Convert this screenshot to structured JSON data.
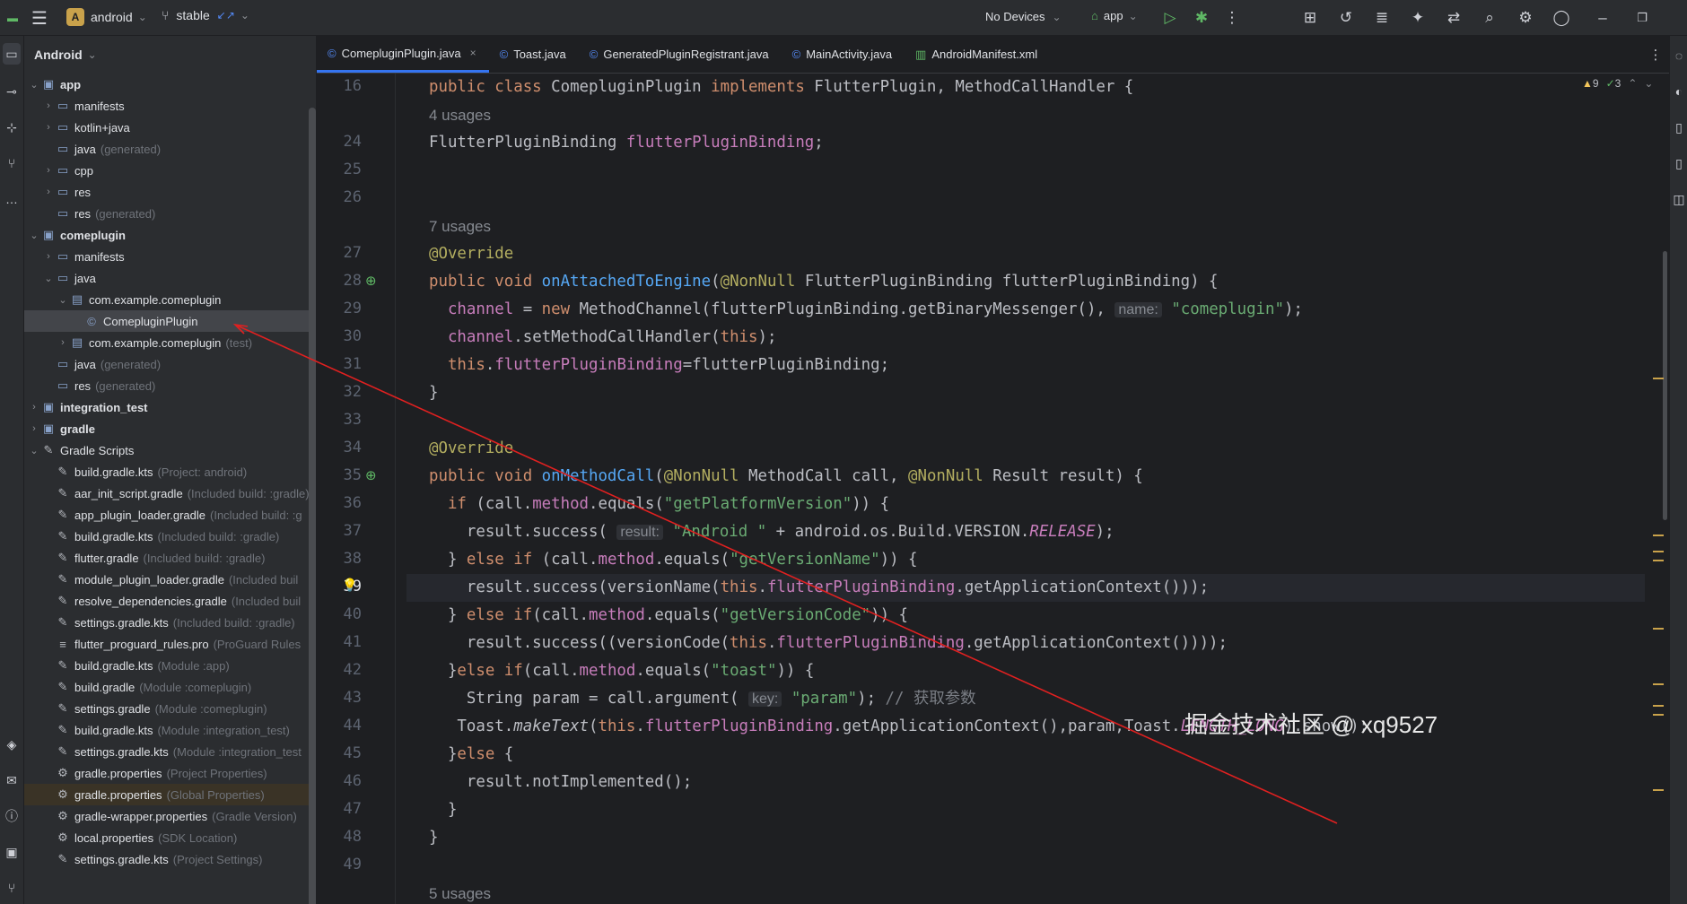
{
  "topbar": {
    "project_badge": "A",
    "project_name": "android",
    "branch": "stable",
    "devices": "No Devices",
    "run_config": "app",
    "chevron": "⌄"
  },
  "project_panel": {
    "header": "Android",
    "tree": [
      {
        "label": "app",
        "hint": "",
        "bold": true,
        "level": 0,
        "chev": "⌄",
        "icon": "folder-module-icon"
      },
      {
        "label": "manifests",
        "hint": "",
        "level": 1,
        "chev": "›",
        "icon": "folder-icon"
      },
      {
        "label": "kotlin+java",
        "hint": "",
        "level": 1,
        "chev": "›",
        "icon": "folder-icon"
      },
      {
        "label": "java",
        "hint": "(generated)",
        "level": 1,
        "chev": "",
        "icon": "folder-icon"
      },
      {
        "label": "cpp",
        "hint": "",
        "level": 1,
        "chev": "›",
        "icon": "folder-icon"
      },
      {
        "label": "res",
        "hint": "",
        "level": 1,
        "chev": "›",
        "icon": "folder-icon"
      },
      {
        "label": "res",
        "hint": "(generated)",
        "level": 1,
        "chev": "",
        "icon": "folder-icon"
      },
      {
        "label": "comeplugin",
        "hint": "",
        "bold": true,
        "level": 0,
        "chev": "⌄",
        "icon": "folder-module-icon"
      },
      {
        "label": "manifests",
        "hint": "",
        "level": 1,
        "chev": "›",
        "icon": "folder-icon"
      },
      {
        "label": "java",
        "hint": "",
        "level": 1,
        "chev": "⌄",
        "icon": "folder-icon"
      },
      {
        "label": "com.example.comeplugin",
        "hint": "",
        "level": 2,
        "chev": "⌄",
        "icon": "package-icon"
      },
      {
        "label": "ComepluginPlugin",
        "hint": "",
        "level": 3,
        "chev": "",
        "icon": "class-icon",
        "selected": true
      },
      {
        "label": "com.example.comeplugin",
        "hint": "(test)",
        "level": 2,
        "chev": "›",
        "icon": "package-icon"
      },
      {
        "label": "java",
        "hint": "(generated)",
        "level": 1,
        "chev": "",
        "icon": "folder-icon"
      },
      {
        "label": "res",
        "hint": "(generated)",
        "level": 1,
        "chev": "",
        "icon": "folder-icon"
      },
      {
        "label": "integration_test",
        "hint": "",
        "bold": true,
        "level": 0,
        "chev": "›",
        "icon": "folder-module-icon"
      },
      {
        "label": "gradle",
        "hint": "",
        "bold": true,
        "level": 0,
        "chev": "›",
        "icon": "folder-module-icon"
      },
      {
        "label": "Gradle Scripts",
        "hint": "",
        "level": 0,
        "chev": "⌄",
        "icon": "gradle-icon"
      },
      {
        "label": "build.gradle.kts",
        "hint": "(Project: android)",
        "level": 1,
        "chev": "",
        "icon": "gradle-icon"
      },
      {
        "label": "aar_init_script.gradle",
        "hint": "(Included build: :gradle)",
        "level": 1,
        "chev": "",
        "icon": "gradle-icon"
      },
      {
        "label": "app_plugin_loader.gradle",
        "hint": "(Included build: :g",
        "level": 1,
        "chev": "",
        "icon": "gradle-icon"
      },
      {
        "label": "build.gradle.kts",
        "hint": "(Included build: :gradle)",
        "level": 1,
        "chev": "",
        "icon": "gradle-icon"
      },
      {
        "label": "flutter.gradle",
        "hint": "(Included build: :gradle)",
        "level": 1,
        "chev": "",
        "icon": "gradle-icon"
      },
      {
        "label": "module_plugin_loader.gradle",
        "hint": "(Included buil",
        "level": 1,
        "chev": "",
        "icon": "gradle-icon"
      },
      {
        "label": "resolve_dependencies.gradle",
        "hint": "(Included buil",
        "level": 1,
        "chev": "",
        "icon": "gradle-icon"
      },
      {
        "label": "settings.gradle.kts",
        "hint": "(Included build: :gradle)",
        "level": 1,
        "chev": "",
        "icon": "gradle-icon"
      },
      {
        "label": "flutter_proguard_rules.pro",
        "hint": "(ProGuard Rules",
        "level": 1,
        "chev": "",
        "icon": "text-file-icon"
      },
      {
        "label": "build.gradle.kts",
        "hint": "(Module :app)",
        "level": 1,
        "chev": "",
        "icon": "gradle-icon"
      },
      {
        "label": "build.gradle",
        "hint": "(Module :comeplugin)",
        "level": 1,
        "chev": "",
        "icon": "gradle-icon"
      },
      {
        "label": "settings.gradle",
        "hint": "(Module :comeplugin)",
        "level": 1,
        "chev": "",
        "icon": "gradle-icon"
      },
      {
        "label": "build.gradle.kts",
        "hint": "(Module :integration_test)",
        "level": 1,
        "chev": "",
        "icon": "gradle-icon"
      },
      {
        "label": "settings.gradle.kts",
        "hint": "(Module :integration_test",
        "level": 1,
        "chev": "",
        "icon": "gradle-icon"
      },
      {
        "label": "gradle.properties",
        "hint": "(Project Properties)",
        "level": 1,
        "chev": "",
        "icon": "settings-file-icon"
      },
      {
        "label": "gradle.properties",
        "hint": "(Global Properties)",
        "level": 1,
        "chev": "",
        "icon": "settings-file-icon",
        "highlight": true
      },
      {
        "label": "gradle-wrapper.properties",
        "hint": "(Gradle Version)",
        "level": 1,
        "chev": "",
        "icon": "settings-file-icon"
      },
      {
        "label": "local.properties",
        "hint": "(SDK Location)",
        "level": 1,
        "chev": "",
        "icon": "settings-file-icon"
      },
      {
        "label": "settings.gradle.kts",
        "hint": "(Project Settings)",
        "level": 1,
        "chev": "",
        "icon": "gradle-icon"
      }
    ]
  },
  "tabs": [
    {
      "label": "ComepluginPlugin.java",
      "active": true,
      "icon": "java-class-icon"
    },
    {
      "label": "Toast.java",
      "icon": "java-class-icon"
    },
    {
      "label": "GeneratedPluginRegistrant.java",
      "icon": "java-class-icon"
    },
    {
      "label": "MainActivity.java",
      "icon": "java-class-icon"
    },
    {
      "label": "AndroidManifest.xml",
      "icon": "manifest-icon"
    }
  ],
  "inspections": {
    "warnings": "9",
    "ok": "3"
  },
  "editor": {
    "current_line": "39",
    "lines": [
      {
        "n": "16",
        "html": "<span class='kw'>public class </span>ComepluginPlugin <span class='kw'>implements </span>FlutterPlugin, MethodCallHandler {"
      },
      {
        "n": "",
        "html": "<span class='usage'>4 usages</span>"
      },
      {
        "n": "24",
        "html": "FlutterPluginBinding <span class='fd'>flutterPluginBinding</span>;"
      },
      {
        "n": "25",
        "html": ""
      },
      {
        "n": "26",
        "html": ""
      },
      {
        "n": "",
        "html": "<span class='usage'>7 usages</span>"
      },
      {
        "n": "27",
        "html": "<span class='an'>@Override</span>"
      },
      {
        "n": "28",
        "html": "<span class='kw'>public void </span><span class='fn'>onAttachedToEngine</span>(<span class='an'>@NonNull </span>FlutterPluginBinding flutterPluginBinding) {",
        "gicon": true
      },
      {
        "n": "29",
        "html": "  <span class='fd'>channel</span> = <span class='kw'>new </span>MethodChannel(flutterPluginBinding.getBinaryMessenger(), <span class='ih'>name:</span> <span class='st'>\"comeplugin\"</span>);"
      },
      {
        "n": "30",
        "html": "  <span class='fd'>channel</span>.setMethodCallHandler(<span class='kw'>this</span>);"
      },
      {
        "n": "31",
        "html": "  <span class='kw'>this</span>.<span class='fd'>flutterPluginBinding</span>=flutterPluginBinding;"
      },
      {
        "n": "32",
        "html": "}"
      },
      {
        "n": "33",
        "html": ""
      },
      {
        "n": "34",
        "html": "<span class='an'>@Override</span>"
      },
      {
        "n": "35",
        "html": "<span class='kw'>public void </span><span class='fn'>onMethodCall</span>(<span class='an'>@NonNull </span>MethodCall call, <span class='an'>@NonNull </span>Result result) {",
        "gicon": true
      },
      {
        "n": "36",
        "html": "  <span class='kw'>if </span>(call.<span class='fd'>method</span>.equals(<span class='st'>\"getPlatformVersion\"</span>)) {"
      },
      {
        "n": "37",
        "html": "    result.success( <span class='ih'>result:</span> <span class='st'>\"Android \"</span> + android.os.Build.VERSION.<span class='fd it'>RELEASE</span>);"
      },
      {
        "n": "38",
        "html": "  } <span class='kw'>else if </span>(call.<span class='fd'>method</span>.equals(<span class='st'>\"getVersionName\"</span>)) {"
      },
      {
        "n": "39",
        "html": "    result.success(versionName(<span class='kw'>this</span>.<span class='fd'>flutterPluginBinding</span>.getApplicationContext()));",
        "bulb": true
      },
      {
        "n": "40",
        "html": "  } <span class='kw'>else if</span>(call.<span class='fd'>method</span>.equals(<span class='st'>\"getVersionCode\"</span>)) {"
      },
      {
        "n": "41",
        "html": "    result.success((versionCode(<span class='kw'>this</span>.<span class='fd'>flutterPluginBinding</span>.getApplicationContext())));"
      },
      {
        "n": "42",
        "html": "  }<span class='kw'>else if</span>(call.<span class='fd'>method</span>.equals(<span class='st'>\"toast\"</span>)) {"
      },
      {
        "n": "43",
        "html": "    String param = call.argument( <span class='ih'>key:</span> <span class='st'>\"param\"</span>); <span class='cm'>// 获取参数</span>"
      },
      {
        "n": "44",
        "html": "   Toast.<span class='it'>makeText</span>(<span class='kw'>this</span>.<span class='fd'>flutterPluginBinding</span>.getApplicationContext(),param,Toast.<span class='fd it'>LENGTH_LONG</span>).show();"
      },
      {
        "n": "45",
        "html": "  }<span class='kw'>else </span>{"
      },
      {
        "n": "46",
        "html": "    result.notImplemented();"
      },
      {
        "n": "47",
        "html": "  }"
      },
      {
        "n": "48",
        "html": "}"
      },
      {
        "n": "49",
        "html": ""
      },
      {
        "n": "",
        "html": "<span class='usage'>5 usages</span>"
      }
    ]
  },
  "watermark": "掘金技术社区 @ xq9527",
  "colors": {
    "accent": "#3574f0",
    "annotation_line": "#e02020"
  }
}
